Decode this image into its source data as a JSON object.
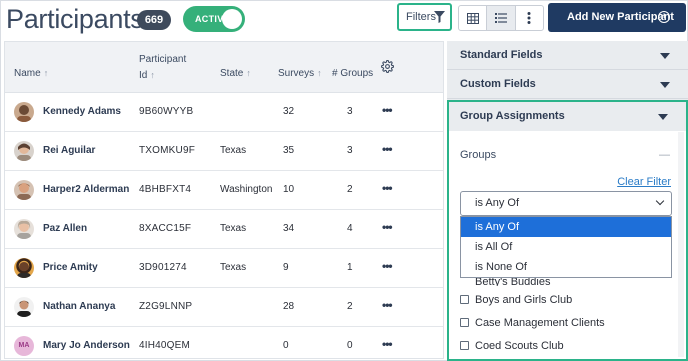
{
  "header": {
    "title": "Participants",
    "count": "669",
    "active_label": "ACTIVE",
    "filters_label": "Filters",
    "add_button_label": "Add New Participant"
  },
  "table": {
    "columns": {
      "name": "Name",
      "participant_id_line1": "Participant",
      "participant_id_line2": "Id",
      "state": "State",
      "surveys": "Surveys",
      "groups": "# Groups"
    },
    "rows": [
      {
        "name": "Kennedy Adams",
        "id": "9B60WYYB",
        "state": "",
        "surveys": "32",
        "groups": "3",
        "actions": "•••"
      },
      {
        "name": "Rei Aguilar",
        "id": "TXOMKU9F",
        "state": "Texas",
        "surveys": "35",
        "groups": "3",
        "actions": "•••"
      },
      {
        "name": "Harper2 Alderman",
        "id": "4BHBFXT4",
        "state": "Washington",
        "surveys": "10",
        "groups": "2",
        "actions": "•••"
      },
      {
        "name": "Paz Allen",
        "id": "8XACC15F",
        "state": "Texas",
        "surveys": "34",
        "groups": "4",
        "actions": "•••"
      },
      {
        "name": "Price Amity",
        "id": "3D901274",
        "state": "Texas",
        "surveys": "9",
        "groups": "1",
        "actions": "•••"
      },
      {
        "name": "Nathan Ananya",
        "id": "Z2G9LNNP",
        "state": "",
        "surveys": "28",
        "groups": "2",
        "actions": "•••"
      },
      {
        "name": "Mary Jo Anderson",
        "id": "4IH40QEM",
        "state": "",
        "surveys": "0",
        "groups": "0",
        "actions": "•••",
        "initials": "MA"
      }
    ]
  },
  "panel": {
    "standard_fields": "Standard Fields",
    "custom_fields": "Custom Fields",
    "group_assignments": "Group Assignments",
    "groups_label": "Groups",
    "collapse_symbol": "—",
    "clear_filter": "Clear Filter",
    "select_value": "is Any Of",
    "options": [
      "is Any Of",
      "is All Of",
      "is None Of"
    ],
    "partial_item": "Betty's Buddies",
    "checkbox_items": [
      "Boys and Girls Club",
      "Case Management Clients",
      "Coed Scouts Club"
    ]
  },
  "colors": {
    "accent_green": "#35b07a",
    "focus_teal": "#2bb38a",
    "navy_button": "#1f3a62",
    "highlight_blue": "#1e6fd9",
    "link_blue": "#2a7cc7"
  }
}
